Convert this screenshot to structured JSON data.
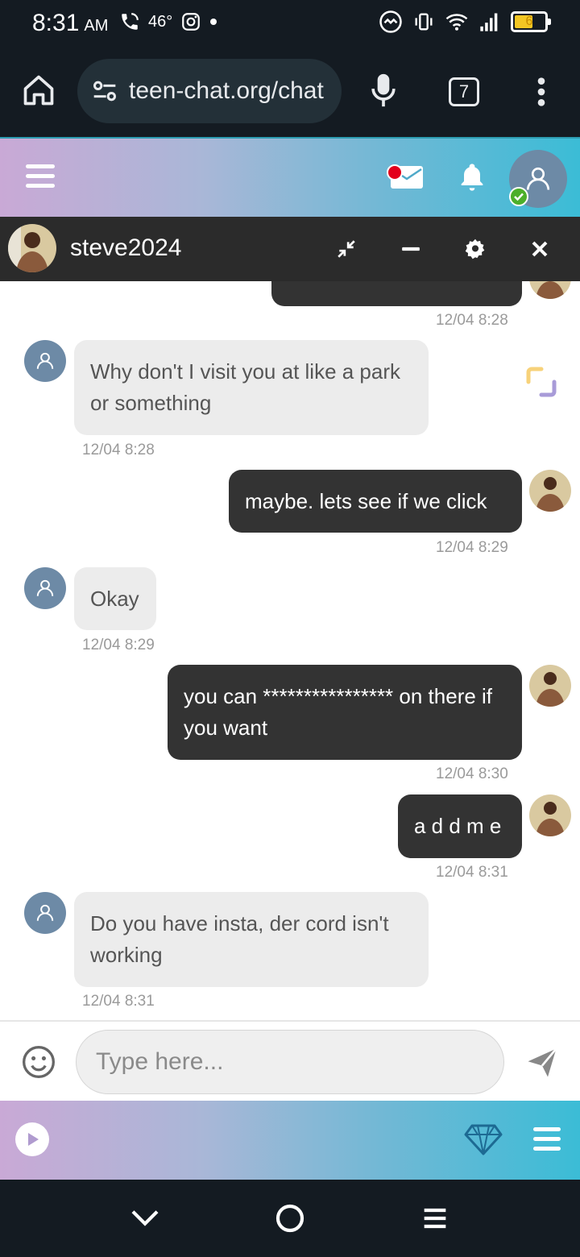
{
  "status_bar": {
    "time": "8:31",
    "ampm": "AM",
    "temperature": "46°",
    "battery_level": "6"
  },
  "browser": {
    "url": "teen-chat.org/chat",
    "tab_count": "7"
  },
  "chat": {
    "contact_name": "steve2024",
    "messages": [
      {
        "direction": "out",
        "text": "",
        "time": "12/04 8:28"
      },
      {
        "direction": "in",
        "text": "Why don't I visit you at like a park or something",
        "time": "12/04 8:28"
      },
      {
        "direction": "out",
        "text": "maybe. lets see if we click",
        "time": "12/04 8:29"
      },
      {
        "direction": "in",
        "text": "Okay",
        "time": "12/04 8:29"
      },
      {
        "direction": "out",
        "text": "you can **************** on there if you want",
        "time": "12/04 8:30"
      },
      {
        "direction": "out",
        "text": "a d d m e",
        "time": "12/04 8:31"
      },
      {
        "direction": "in",
        "text": "Do you have insta, der cord isn't working",
        "time": "12/04 8:31"
      }
    ]
  },
  "input": {
    "placeholder": "Type here..."
  },
  "colors": {
    "header_gradient_start": "#c9a9d6",
    "header_gradient_end": "#3bbcd6",
    "outgoing_bubble": "#333333",
    "incoming_bubble": "#ececec",
    "avatar_bg": "#6d8aa6",
    "notification_red": "#e3001b",
    "online_green": "#4caf2a"
  },
  "icons": [
    "phone-wifi-icon",
    "instagram-icon",
    "home-icon",
    "mic-icon",
    "more-icon",
    "menu-icon",
    "mail-icon",
    "bell-icon",
    "user-icon",
    "minimize-arrows-icon",
    "minus-icon",
    "gear-icon",
    "close-icon",
    "emoji-icon",
    "send-icon",
    "play-icon",
    "diamond-icon",
    "back-chevron-icon",
    "home-circle-icon",
    "recents-icon"
  ]
}
